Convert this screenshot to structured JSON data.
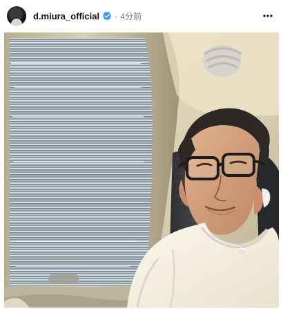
{
  "post": {
    "username": "d.miura_official",
    "separator": "·",
    "time": "4分前"
  },
  "icons": {
    "verified": "verified-badge-icon",
    "more": "more-options-icon"
  },
  "colors": {
    "verified_blue": "#3897f0",
    "muted_text": "#777777"
  }
}
